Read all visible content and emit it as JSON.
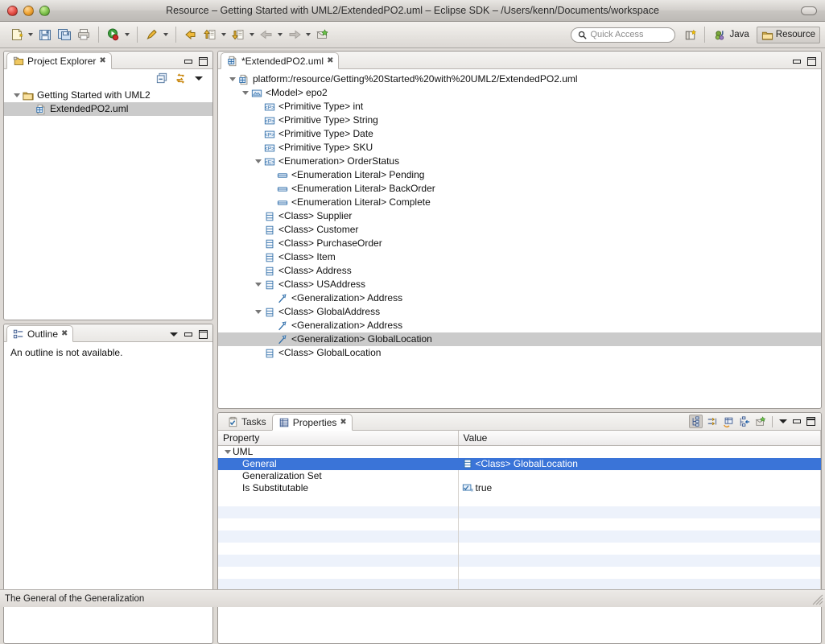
{
  "window": {
    "title": "Resource – Getting Started with UML2/ExtendedPO2.uml – Eclipse SDK – /Users/kenn/Documents/workspace"
  },
  "toolbar": {
    "items": [
      {
        "name": "new-wizard",
        "icon": "new-file-icon",
        "dropdown": true
      },
      {
        "name": "save",
        "icon": "save-icon",
        "dropdown": false
      },
      {
        "name": "save-all",
        "icon": "save-all-icon",
        "dropdown": false
      },
      {
        "name": "print",
        "icon": "print-icon",
        "dropdown": false
      },
      {
        "name": "run",
        "icon": "run-icon",
        "dropdown": true
      },
      {
        "name": "external-tools",
        "icon": "external-tools-icon",
        "dropdown": true
      },
      {
        "name": "back-to-file",
        "icon": "back-to-file-icon",
        "dropdown": false
      },
      {
        "name": "previous-annotation",
        "icon": "up-arrow-icon",
        "dropdown": true
      },
      {
        "name": "next-annotation",
        "icon": "down-arrow-icon",
        "dropdown": true
      },
      {
        "name": "back",
        "icon": "left-arrow-icon",
        "dropdown": true
      },
      {
        "name": "forward",
        "icon": "right-arrow-icon",
        "dropdown": true
      },
      {
        "name": "new-editor",
        "icon": "new-editor-icon",
        "dropdown": false
      }
    ],
    "quick_access_placeholder": "Quick Access",
    "perspectives": [
      {
        "label": "Java",
        "icon": "java-perspective-icon",
        "active": false
      },
      {
        "label": "Resource",
        "icon": "resource-perspective-icon",
        "active": true
      }
    ],
    "open_perspective_label": "Open Perspective"
  },
  "project_explorer": {
    "tab_label": "Project Explorer",
    "tools": [
      {
        "name": "collapse-all-icon"
      },
      {
        "name": "link-with-editor-icon"
      },
      {
        "name": "view-menu-icon"
      }
    ],
    "tree": [
      {
        "label": "Getting Started with UML2",
        "icon": "project-folder-icon",
        "indent": 0,
        "twisty": "open",
        "selected": false
      },
      {
        "label": "ExtendedPO2.uml",
        "icon": "uml-file-icon",
        "indent": 1,
        "twisty": "none",
        "selected": true
      }
    ]
  },
  "outline": {
    "tab_label": "Outline",
    "message": "An outline is not available."
  },
  "editor": {
    "tab_label": "*ExtendedPO2.uml",
    "tab_icon": "uml-file-icon",
    "tree": [
      {
        "label": "platform:/resource/Getting%20Started%20with%20UML2/ExtendedPO2.uml",
        "icon": "resource-icon",
        "indent": 0,
        "twisty": "open",
        "selected": false
      },
      {
        "label": "<Model> epo2",
        "icon": "model-icon",
        "indent": 1,
        "twisty": "open",
        "selected": false
      },
      {
        "label": "<Primitive Type> int",
        "icon": "primitive-type-icon",
        "indent": 2,
        "twisty": "none",
        "selected": false
      },
      {
        "label": "<Primitive Type> String",
        "icon": "primitive-type-icon",
        "indent": 2,
        "twisty": "none",
        "selected": false
      },
      {
        "label": "<Primitive Type> Date",
        "icon": "primitive-type-icon",
        "indent": 2,
        "twisty": "none",
        "selected": false
      },
      {
        "label": "<Primitive Type> SKU",
        "icon": "primitive-type-icon",
        "indent": 2,
        "twisty": "none",
        "selected": false
      },
      {
        "label": "<Enumeration> OrderStatus",
        "icon": "enumeration-icon",
        "indent": 2,
        "twisty": "open",
        "selected": false
      },
      {
        "label": "<Enumeration Literal> Pending",
        "icon": "enumeration-literal-icon",
        "indent": 3,
        "twisty": "none",
        "selected": false
      },
      {
        "label": "<Enumeration Literal> BackOrder",
        "icon": "enumeration-literal-icon",
        "indent": 3,
        "twisty": "none",
        "selected": false
      },
      {
        "label": "<Enumeration Literal> Complete",
        "icon": "enumeration-literal-icon",
        "indent": 3,
        "twisty": "none",
        "selected": false
      },
      {
        "label": "<Class> Supplier",
        "icon": "class-icon",
        "indent": 2,
        "twisty": "none",
        "selected": false
      },
      {
        "label": "<Class> Customer",
        "icon": "class-icon",
        "indent": 2,
        "twisty": "none",
        "selected": false
      },
      {
        "label": "<Class> PurchaseOrder",
        "icon": "class-icon",
        "indent": 2,
        "twisty": "none",
        "selected": false
      },
      {
        "label": "<Class> Item",
        "icon": "class-icon",
        "indent": 2,
        "twisty": "none",
        "selected": false
      },
      {
        "label": "<Class> Address",
        "icon": "class-icon",
        "indent": 2,
        "twisty": "none",
        "selected": false
      },
      {
        "label": "<Class> USAddress",
        "icon": "class-icon",
        "indent": 2,
        "twisty": "open",
        "selected": false
      },
      {
        "label": "<Generalization> Address",
        "icon": "generalization-icon",
        "indent": 3,
        "twisty": "none",
        "selected": false
      },
      {
        "label": "<Class> GlobalAddress",
        "icon": "class-icon",
        "indent": 2,
        "twisty": "open",
        "selected": false
      },
      {
        "label": "<Generalization> Address",
        "icon": "generalization-icon",
        "indent": 3,
        "twisty": "none",
        "selected": false
      },
      {
        "label": "<Generalization> GlobalLocation",
        "icon": "generalization-icon",
        "indent": 3,
        "twisty": "none",
        "selected": true
      },
      {
        "label": "<Class> GlobalLocation",
        "icon": "class-icon",
        "indent": 2,
        "twisty": "none",
        "selected": false
      }
    ]
  },
  "bottom": {
    "tabs": [
      {
        "label": "Tasks",
        "icon": "tasks-icon",
        "selected": false
      },
      {
        "label": "Properties",
        "icon": "properties-icon",
        "selected": true
      }
    ],
    "tools": [
      {
        "name": "show-categories-icon",
        "active": true
      },
      {
        "name": "show-advanced-properties-icon",
        "active": false
      },
      {
        "name": "restore-default-value-icon",
        "active": false
      },
      {
        "name": "pin-to-selection-icon",
        "active": false
      },
      {
        "name": "new-properties-view-icon",
        "active": false
      }
    ],
    "view_menu_icon": "view-menu-icon",
    "minimize_icon": "minimize-icon",
    "maximize_icon": "maximize-icon",
    "columns": [
      "Property",
      "Value"
    ],
    "rows": [
      {
        "property": "UML",
        "value": "",
        "value_icon": "",
        "category": true,
        "selected": false
      },
      {
        "property": "General",
        "value": "<Class> GlobalLocation",
        "value_icon": "class-icon",
        "category": false,
        "selected": true
      },
      {
        "property": "Generalization Set",
        "value": "",
        "value_icon": "",
        "category": false,
        "selected": false
      },
      {
        "property": "Is Substitutable",
        "value": "true",
        "value_icon": "boolean-icon",
        "category": false,
        "selected": false
      }
    ],
    "empty_row_count": 9
  },
  "statusbar": {
    "message": "The General of the Generalization"
  },
  "colors": {
    "selection_blue": "#3a74d8",
    "selection_gray": "#cbcbcb",
    "alt_row": "#edf2fb",
    "chrome": "#dedad6"
  }
}
